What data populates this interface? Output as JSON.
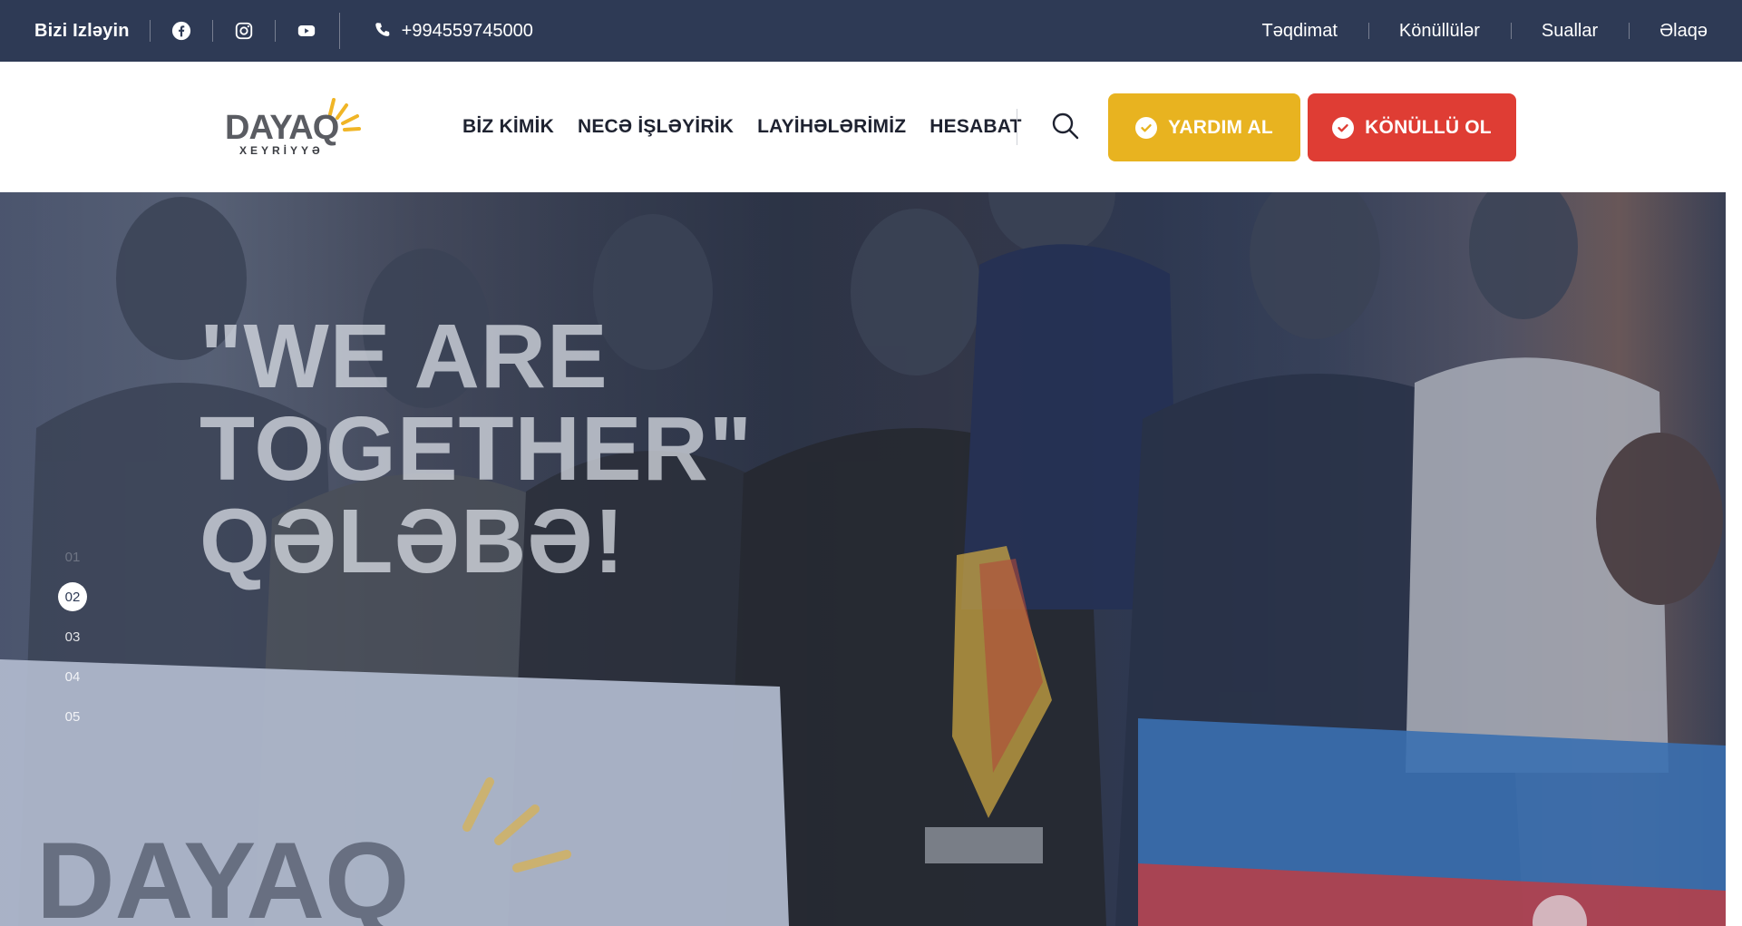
{
  "topbar": {
    "follow_label": "Bizi Izləyin",
    "social": [
      {
        "name": "facebook-icon"
      },
      {
        "name": "instagram-icon"
      },
      {
        "name": "youtube-icon"
      }
    ],
    "phone": "+994559745000",
    "links": [
      "Təqdimat",
      "Könüllülər",
      "Suallar",
      "Əlaqə"
    ],
    "background_color": "#2e3a55"
  },
  "logo": {
    "word": "DAYAQ",
    "sub": "XEYRİYYƏ"
  },
  "nav": {
    "items": [
      "BİZ KİMİK",
      "NECƏ İŞLƏYİRİK",
      "LAYİHƏLƏRİMİZ",
      "HESABAT"
    ]
  },
  "actions": {
    "help_label": "YARDIM AL",
    "volunteer_label": "KÖNÜLLÜ OL",
    "help_color": "#e8b320",
    "volunteer_color": "#df3d34"
  },
  "hero": {
    "title_line1": "\"WE ARE",
    "title_line2": "TOGETHER\"",
    "title_line3": "QƏLƏBƏ!",
    "slides": [
      "01",
      "02",
      "03",
      "04",
      "05"
    ],
    "active_slide": "02"
  }
}
